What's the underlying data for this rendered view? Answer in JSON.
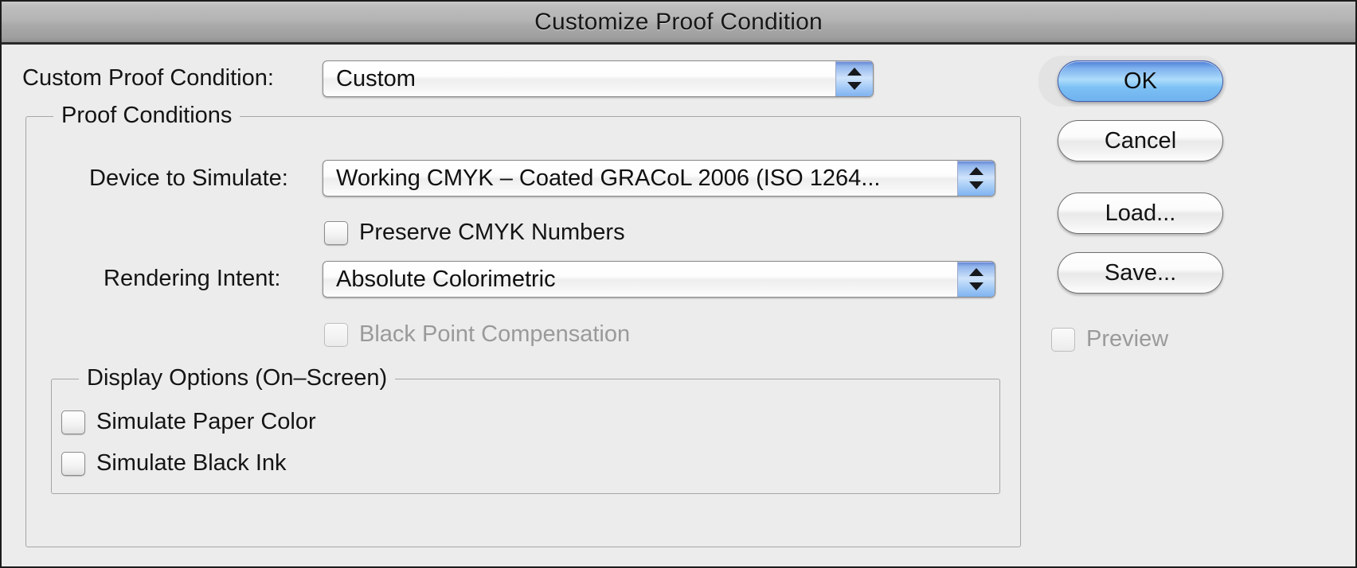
{
  "window": {
    "title": "Customize Proof Condition"
  },
  "custom_proof_condition": {
    "label": "Custom Proof Condition:",
    "value": "Custom"
  },
  "proof_conditions": {
    "legend": "Proof Conditions",
    "device_to_simulate": {
      "label": "Device to Simulate:",
      "value": "Working CMYK – Coated GRACoL 2006 (ISO 1264..."
    },
    "preserve_cmyk_numbers": {
      "label": "Preserve CMYK Numbers",
      "checked": false
    },
    "rendering_intent": {
      "label": "Rendering Intent:",
      "value": "Absolute Colorimetric"
    },
    "black_point_compensation": {
      "label": "Black Point Compensation",
      "checked": false,
      "disabled": true
    },
    "display_options": {
      "legend": "Display Options (On–Screen)",
      "simulate_paper_color": {
        "label": "Simulate Paper Color",
        "checked": false
      },
      "simulate_black_ink": {
        "label": "Simulate Black Ink",
        "checked": false
      }
    }
  },
  "buttons": {
    "ok": "OK",
    "cancel": "Cancel",
    "load": "Load...",
    "save": "Save..."
  },
  "preview": {
    "label": "Preview",
    "checked": false,
    "disabled": true
  },
  "colors": {
    "window_bg": "#ececec",
    "accent_blue": "#7eb2ee",
    "text": "#141414",
    "disabled_text": "#9a9a9a"
  }
}
